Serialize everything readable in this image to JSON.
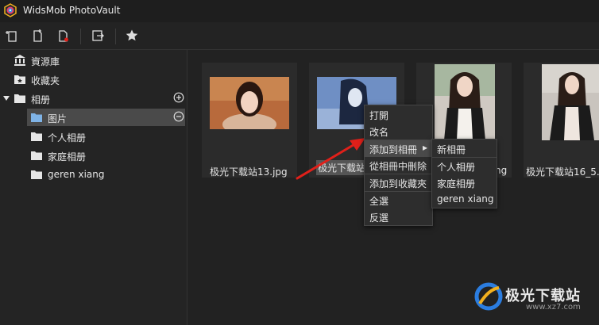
{
  "app": {
    "title": "WidsMob PhotoVault"
  },
  "toolbar": {
    "buttons": [
      {
        "icon": "import-photo-icon"
      },
      {
        "icon": "new-file-icon"
      },
      {
        "icon": "delete-file-icon"
      },
      {
        "icon": "export-icon"
      },
      {
        "icon": "star-icon"
      }
    ]
  },
  "sidebar": {
    "library": "資源庫",
    "favorites": "收藏夹",
    "albums": "相册",
    "album_items": [
      "图片",
      "个人相册",
      "家庭相册",
      "geren xiang"
    ]
  },
  "gallery": {
    "items": [
      {
        "name": "极光下载站13.jpg"
      },
      {
        "name": "极光下载站"
      },
      {
        "name": "ng"
      },
      {
        "name": "极光下载站16_5."
      }
    ]
  },
  "context_menu": {
    "items": [
      "打開",
      "改名",
      "添加到相冊",
      "從相冊中刪除",
      "添加到收藏夾",
      "全選",
      "反選"
    ],
    "submenu_arrow": "▸"
  },
  "submenu": {
    "items": [
      "新相冊",
      "个人相册",
      "家庭相册",
      "geren xiang"
    ]
  },
  "watermark": {
    "text": "极光下载站",
    "url": "www.xz7.com"
  },
  "colors": {
    "accent_red": "#e0201a",
    "selected_bg": "#4a4a4a",
    "folder_blue": "#7fb3e6"
  }
}
